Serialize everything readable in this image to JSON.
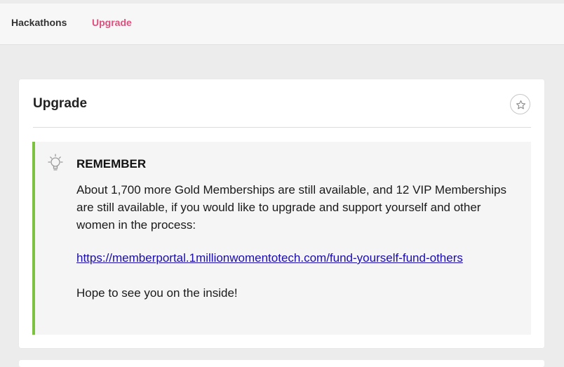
{
  "nav": {
    "items": [
      {
        "label": "Hackathons"
      },
      {
        "label": "Upgrade"
      }
    ]
  },
  "card": {
    "title": "Upgrade",
    "favorite_icon": "star-outline-icon"
  },
  "callout": {
    "icon": "lightbulb-icon",
    "heading": "REMEMBER",
    "body": "About 1,700 more Gold Memberships are still available, and 12 VIP Memberships are still available, if you would like to upgrade and support yourself and other women in the process:",
    "link": "https://memberportal.1millionwomentotech.com/fund-yourself-fund-others",
    "closing": "Hope to see you on the inside!"
  },
  "colors": {
    "accent": "#e0507e",
    "callout_border": "#7cc142",
    "link": "#1a0dab"
  }
}
